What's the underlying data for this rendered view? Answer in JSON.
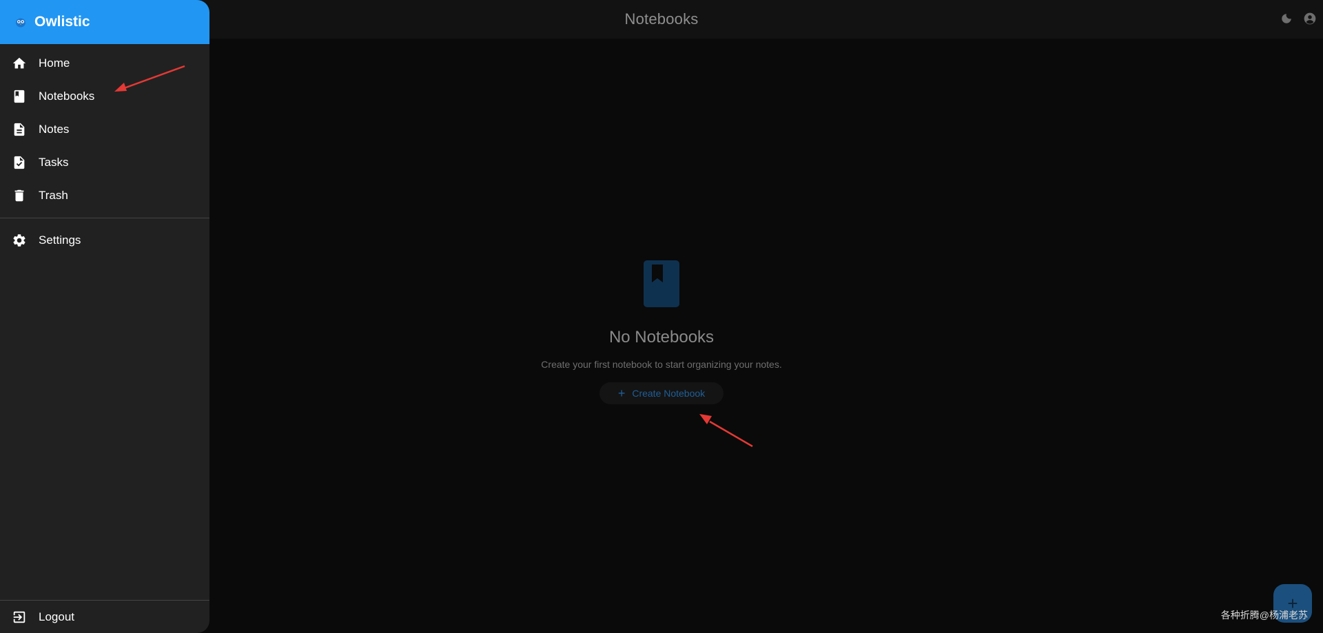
{
  "app": {
    "brand": "Owlistic",
    "page_title": "Notebooks"
  },
  "sidebar": {
    "items": [
      {
        "label": "Home",
        "icon": "home-icon"
      },
      {
        "label": "Notebooks",
        "icon": "notebook-icon"
      },
      {
        "label": "Notes",
        "icon": "note-icon"
      },
      {
        "label": "Tasks",
        "icon": "task-icon"
      },
      {
        "label": "Trash",
        "icon": "trash-icon"
      }
    ],
    "settings": {
      "label": "Settings",
      "icon": "gear-icon"
    },
    "logout": {
      "label": "Logout",
      "icon": "logout-icon"
    }
  },
  "topbar": {
    "actions": [
      "theme-toggle-icon",
      "account-icon"
    ]
  },
  "empty_state": {
    "title": "No Notebooks",
    "subtitle": "Create your first notebook to start organizing your notes.",
    "button_label": "Create Notebook",
    "icon": "notebook-icon"
  },
  "fab": {
    "symbol": "+"
  },
  "watermark": "各种折腾@杨浦老苏",
  "colors": {
    "accent": "#2196f3",
    "drawer_bg": "#212121",
    "main_bg": "#0a0a0a",
    "annotation_arrow": "#e53935"
  }
}
